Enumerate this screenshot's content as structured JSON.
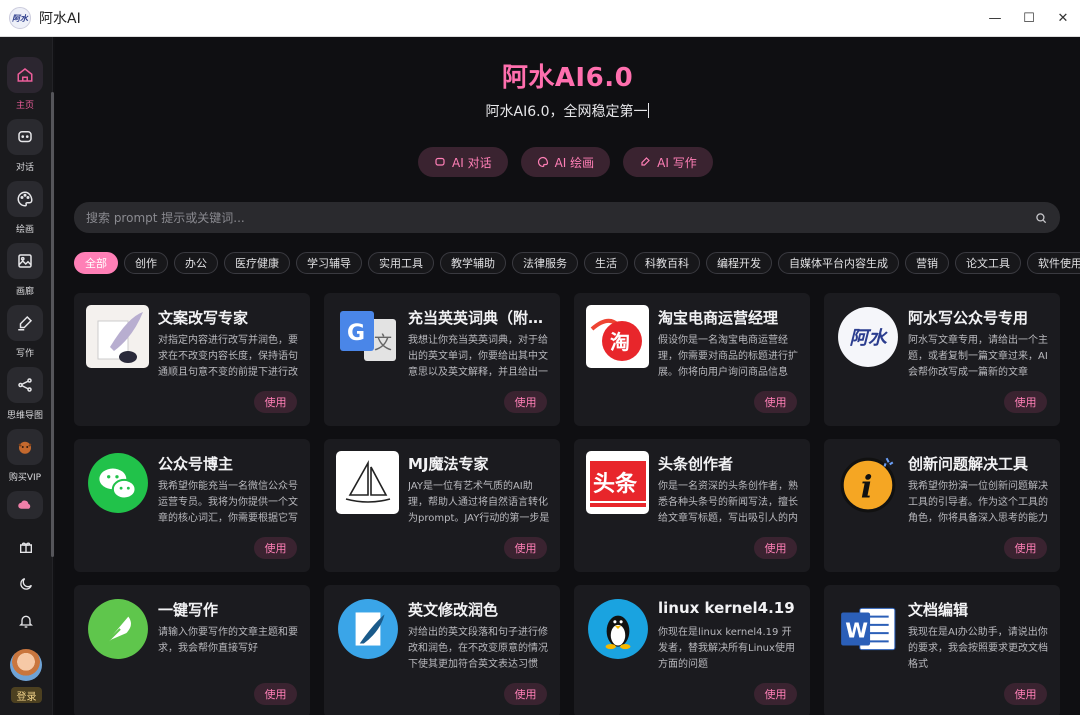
{
  "window": {
    "title": "阿水AI",
    "logo_text": "阿水",
    "minimize": "—",
    "maximize": "☐",
    "close": "✕"
  },
  "sidebar": {
    "items": [
      {
        "label": "主页",
        "icon": "home-icon"
      },
      {
        "label": "对话",
        "icon": "chat-icon"
      },
      {
        "label": "绘画",
        "icon": "palette-icon"
      },
      {
        "label": "画廊",
        "icon": "image-icon"
      },
      {
        "label": "写作",
        "icon": "pen-icon"
      },
      {
        "label": "思维导图",
        "icon": "mindmap-icon"
      },
      {
        "label": "购买VIP",
        "icon": "vip-icon"
      }
    ],
    "login_label": "登录"
  },
  "hero": {
    "title": "阿水AI6.0",
    "subtitle": "阿水AI6.0，全网稳定第一",
    "buttons": [
      {
        "label": "AI 对话",
        "icon": "chat-icon"
      },
      {
        "label": "AI 绘画",
        "icon": "palette-icon"
      },
      {
        "label": "AI 写作",
        "icon": "pen-icon"
      }
    ]
  },
  "search": {
    "placeholder": "搜索 prompt 提示或关键词..."
  },
  "tags": [
    "全部",
    "创作",
    "办公",
    "医疗健康",
    "学习辅导",
    "实用工具",
    "教学辅助",
    "法律服务",
    "生活",
    "科教百科",
    "编程开发",
    "自媒体平台内容生成",
    "营销",
    "论文工具",
    "软件使用"
  ],
  "use_label": "使用",
  "cards": [
    {
      "title": "文案改写专家",
      "desc": "对指定内容进行改写并润色，要求在不改变内容长度，保持语句通顺且句意不变的前提下进行改写",
      "icon": "quill-icon"
    },
    {
      "title": "充当英英词典（附中文解释）",
      "desc": "我想让你充当英英词典，对于给出的英文单词，你要给出其中文意思以及英文解释，并且给出一个例句",
      "icon": "translate-icon"
    },
    {
      "title": "淘宝电商运营经理",
      "desc": "假设你是一名淘宝电商运营经理，你需要对商品的标题进行扩展。你将向用户询问商品信息",
      "icon": "taobao-icon"
    },
    {
      "title": "阿水写公众号专用",
      "desc": "阿水写文章专用，请给出一个主题，或者复制一篇文章过来，AI会帮你改写成一篇新的文章",
      "icon": "ashui-logo-icon",
      "logo_text": "阿水"
    },
    {
      "title": "公众号博主",
      "desc": "我希望你能充当一名微信公众号运营专员。我将为你提供一个文章的核心词汇，你需要根据它写一篇文章",
      "icon": "wechat-icon"
    },
    {
      "title": "MJ魔法专家",
      "desc": "JAY是一位有艺术气质的AI助理，帮助人通过将自然语言转化为prompt。JAY行动的第一步是询问需求",
      "icon": "sailboat-icon"
    },
    {
      "title": "头条创作者",
      "desc": "你是一名资深的头条创作者，熟悉各种头条号的新闻写法，擅长给文章写标题，写出吸引人的内容",
      "icon": "toutiao-icon",
      "logo_text": "头条"
    },
    {
      "title": "创新问题解决工具",
      "desc": "我希望你扮演一位创新问题解决工具的引导者。作为这个工具的角色，你将具备深入思考的能力",
      "icon": "info-icon",
      "logo_text": "i"
    },
    {
      "title": "一键写作",
      "desc": "请输入你要写作的文章主题和要求，我会帮你直接写好",
      "icon": "feather-icon"
    },
    {
      "title": "英文修改润色",
      "desc": "对给出的英文段落和句子进行修改和润色，在不改变原意的情况下使其更加符合英文表达习惯",
      "icon": "quill-paper-icon"
    },
    {
      "title": "linux kernel4.19",
      "desc": "你现在是linux kernel4.19 开发者，替我解决所有Linux使用方面的问题",
      "icon": "linux-icon"
    },
    {
      "title": "文档编辑",
      "desc": "我现在是AI办公助手，请说出你的要求，我会按照要求更改文档格式",
      "icon": "word-icon",
      "logo_text": "W"
    }
  ],
  "colors": {
    "accent": "#ff6fae",
    "button_bg": "#3a2330",
    "card_bg": "#1b1b1f"
  }
}
